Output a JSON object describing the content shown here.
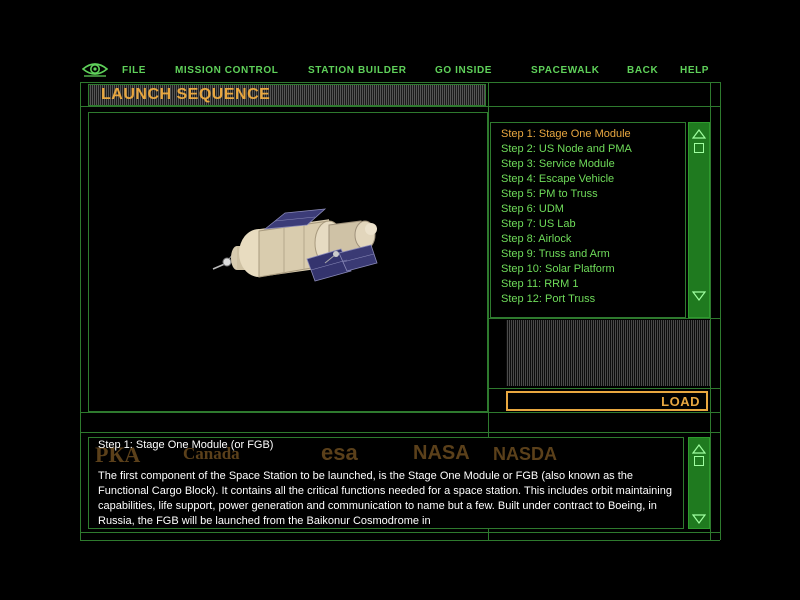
{
  "nav": {
    "items": [
      {
        "label": "FILE"
      },
      {
        "label": "MISSION CONTROL"
      },
      {
        "label": "STATION BUILDER"
      },
      {
        "label": "GO INSIDE"
      },
      {
        "label": "SPACEWALK"
      },
      {
        "label": "BACK"
      },
      {
        "label": "HELP"
      }
    ],
    "eye_icon": "eye-icon"
  },
  "title": "LAUNCH SEQUENCE",
  "steps": [
    "Step 1: Stage One Module",
    "Step 2: US Node and PMA",
    "Step 3: Service Module",
    "Step 4: Escape Vehicle",
    "Step 5: PM to Truss",
    "Step 6: UDM",
    "Step 7: US Lab",
    "Step 8: Airlock",
    "Step 9: Truss and Arm",
    "Step 10: Solar Platform",
    "Step 11: RRM 1",
    "Step 12: Port Truss"
  ],
  "active_step": 0,
  "load_label": "LOAD",
  "info": {
    "heading": "Step 1: Stage One Module (or FGB)",
    "body": "The first component of the Space Station to be launched, is the Stage One Module or FGB (also known as the Functional Cargo Block).  It contains all the critical functions needed for a space station.  This includes orbit maintaining capabilities, life support, power generation and communication to name but a few.  Built under contract to Boeing, in Russia, the FGB will be launched from the Baikonur Cosmodrome in",
    "logos": [
      "Canada",
      "esa",
      "NASA",
      "NASDA"
    ]
  },
  "colors": {
    "accent": "#e8a740",
    "frame": "#2e7a2e",
    "nav_text": "#5fd15a",
    "scrollbar": "#1f7a1f"
  }
}
